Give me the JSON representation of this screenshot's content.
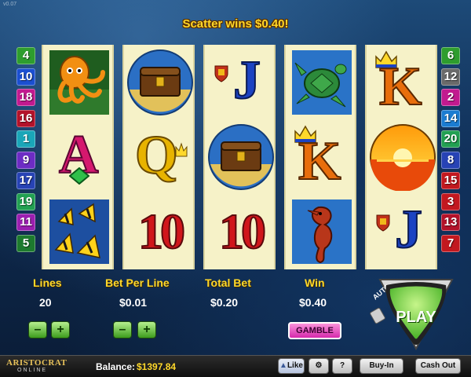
{
  "game": {
    "version": "v0.07",
    "scatter_message": "Scatter wins $0.40!"
  },
  "lines_left": [
    "4",
    "10",
    "18",
    "16",
    "1",
    "9",
    "17",
    "19",
    "11",
    "5"
  ],
  "lines_right": [
    "6",
    "12",
    "2",
    "14",
    "20",
    "8",
    "15",
    "3",
    "13",
    "7"
  ],
  "line_colors_left": [
    "#2e9d2e",
    "#1b4fd1",
    "#c21a8f",
    "#b3122a",
    "#1aa6b8",
    "#6d2cc4",
    "#2743b5",
    "#22a052",
    "#9b1fb0",
    "#1d7a2e"
  ],
  "line_colors_right": [
    "#2e9d2e",
    "#6a6a6a",
    "#c21a8f",
    "#1b7cd1",
    "#22a052",
    "#2743b5",
    "#c2181f",
    "#c2181f",
    "#b3122a",
    "#c2181f"
  ],
  "reels": [
    [
      "octopus",
      "A",
      "butterfly-fish"
    ],
    [
      "treasure-chest",
      "Q",
      "10"
    ],
    [
      "J",
      "treasure-chest",
      "10"
    ],
    [
      "turtle",
      "K",
      "seahorse"
    ],
    [
      "K",
      "sunset",
      "J"
    ]
  ],
  "panel": {
    "lines_label": "Lines",
    "lines_value": "20",
    "bet_per_line_label": "Bet Per Line",
    "bet_per_line_value": "$0.01",
    "total_bet_label": "Total Bet",
    "total_bet_value": "$0.20",
    "win_label": "Win",
    "win_value": "$0.40",
    "minus": "–",
    "plus": "+",
    "gamble_label": "GAMBLE",
    "auto_label": "AUTO",
    "play_label": "PLAY"
  },
  "footer": {
    "logo_text": "ARISTOCRAT",
    "logo_sub": "ONLINE",
    "balance_label": "Balance:",
    "balance_value": "$1397.84",
    "like_label": "Like",
    "help_label": "?",
    "buy_in_label": "Buy-In",
    "cash_out_label": "Cash Out"
  },
  "colors": {
    "reel_bg": "#f6f2c8",
    "label_gold": "#ffd82a",
    "play_green": "#3fae20",
    "ten_red": "#d0161b",
    "card_blue": "#1c43c2",
    "card_magenta": "#d5186e",
    "card_orange": "#e86e0c",
    "card_yellow": "#e7b300"
  }
}
